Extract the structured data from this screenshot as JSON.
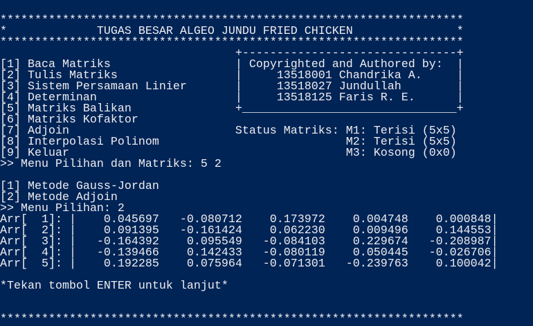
{
  "header": {
    "border": "*******************************************************************",
    "star": "*",
    "title": "TUGAS BESAR ALGEO JUNDU FRIED CHICKEN"
  },
  "menu": [
    {
      "key": "[1]",
      "label": "Baca Matriks"
    },
    {
      "key": "[2]",
      "label": "Tulis Matriks"
    },
    {
      "key": "[3]",
      "label": "Sistem Persamaan Linier"
    },
    {
      "key": "[4]",
      "label": "Determinan"
    },
    {
      "key": "[5]",
      "label": "Matriks Balikan"
    },
    {
      "key": "[6]",
      "label": "Matriks Kofaktor"
    },
    {
      "key": "[7]",
      "label": "Adjoin"
    },
    {
      "key": "[8]",
      "label": "Interpolasi Polinom"
    },
    {
      "key": "[9]",
      "label": "Keluar"
    }
  ],
  "credits": {
    "top_border": "+-------------------------------+",
    "bottom_border": "+_______________________________+",
    "side": "|",
    "heading": "Copyrighted and Authored by:",
    "authors": [
      "13518001 Chandrika A.",
      "13518027 Jundullah",
      "13518125 Faris R. E."
    ]
  },
  "status": {
    "label": "Status Matriks:",
    "items": [
      "M1: Terisi (5x5)",
      "M2: Terisi (5x5)",
      "M3: Kosong (0x0)"
    ]
  },
  "prompt1": ">> Menu Pilihan dan Matriks: 5 2",
  "submenu": [
    {
      "key": "[1]",
      "label": "Metode Gauss-Jordan"
    },
    {
      "key": "[2]",
      "label": "Metode Adjoin"
    }
  ],
  "prompt2": ">> Menu Pilihan: 2",
  "matrix": {
    "rows": [
      {
        "label": "Arr[  1]: |",
        "values": [
          "0.045697",
          "-0.080712",
          "0.173972",
          "0.004748",
          "0.000848"
        ]
      },
      {
        "label": "Arr[  2]: |",
        "values": [
          "0.091395",
          "-0.161424",
          "0.062230",
          "0.009496",
          "0.144553"
        ]
      },
      {
        "label": "Arr[  3]: |",
        "values": [
          "-0.164392",
          "0.095549",
          "-0.084103",
          "0.229674",
          "-0.208987"
        ]
      },
      {
        "label": "Arr[  4]: |",
        "values": [
          "-0.139466",
          "0.142433",
          "-0.080119",
          "0.050445",
          "-0.026706"
        ]
      },
      {
        "label": "Arr[  5]: |",
        "values": [
          "0.192285",
          "0.075964",
          "-0.071301",
          "-0.239763",
          "0.100042"
        ]
      }
    ],
    "end": "|"
  },
  "continue_prompt": "*Tekan tombol ENTER untuk lanjut*"
}
